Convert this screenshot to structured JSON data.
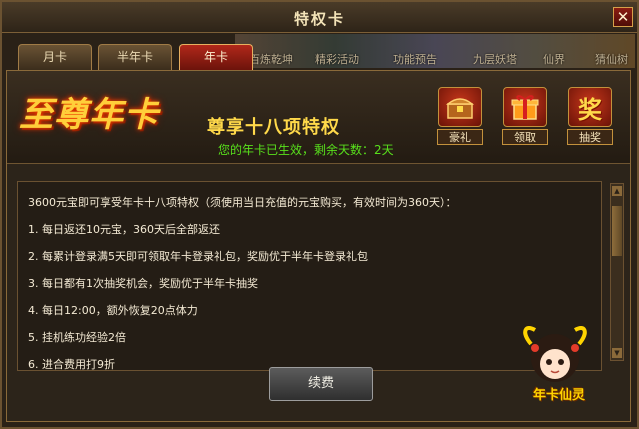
{
  "window": {
    "title": "特权卡"
  },
  "background_labels": [
    "百炼乾坤",
    "精彩活动",
    "功能预告",
    "九层妖塔",
    "仙界",
    "猜仙树"
  ],
  "tabs": [
    {
      "label": "月卡",
      "active": false
    },
    {
      "label": "半年卡",
      "active": false
    },
    {
      "label": "年卡",
      "active": true
    }
  ],
  "header": {
    "logo_text": "至尊年卡",
    "headline": "尊享十八项特权",
    "status": "您的年卡已生效，剩余天数：2天"
  },
  "actions": [
    {
      "label": "豪礼",
      "icon": "treasure-chest-icon"
    },
    {
      "label": "领取",
      "icon": "gift-box-icon"
    },
    {
      "label": "抽奖",
      "icon": "lottery-jiang-icon",
      "glyph": "奖"
    }
  ],
  "content": {
    "intro": "3600元宝即可享受年卡十八项特权（须使用当日充值的元宝购买，有效时间为360天）：",
    "items": [
      "1. 每日返还10元宝，360天后全部返还",
      "2. 每累计登录满5天即可领取年卡登录礼包，奖励优于半年卡登录礼包",
      "3. 每日都有1次抽奖机会，奖励优于半年卡抽奖",
      "4. 每日12:00，额外恢复20点体力",
      "5. 挂机练功经验2倍",
      "6. 进合费用打9折"
    ]
  },
  "renew_button": {
    "label": "续费"
  },
  "mascot": {
    "label": "年卡仙灵"
  },
  "colors": {
    "accent_gold": "#ffd94a",
    "status_green": "#58e01c",
    "tab_active": "#b1281a"
  }
}
